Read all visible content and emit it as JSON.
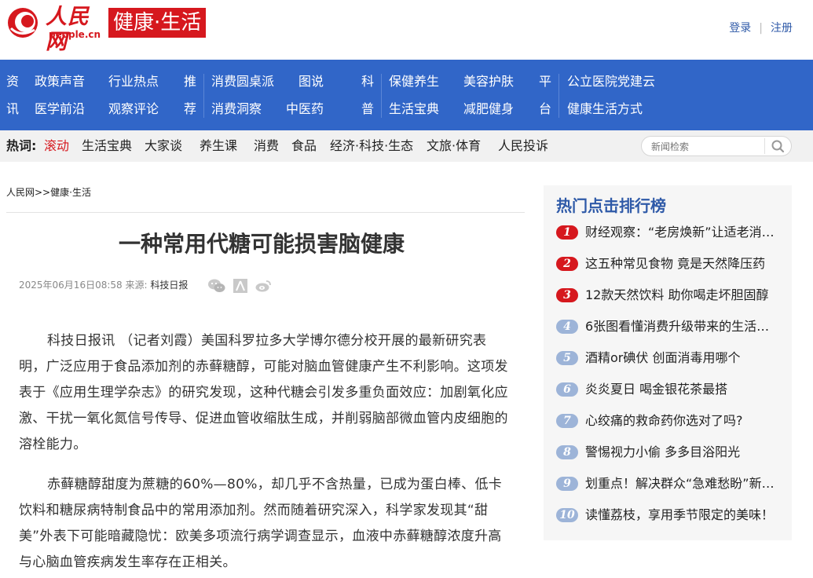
{
  "header": {
    "logo_text": "人民网",
    "logo_sub": "people.cn",
    "channel_title": "健康·生活",
    "login": "登录",
    "register": "注册"
  },
  "nav": {
    "groups": [
      {
        "category": [
          "资",
          "讯"
        ],
        "links": [
          [
            "政策声音",
            "行业热点"
          ],
          [
            "医学前沿",
            "观察评论"
          ]
        ]
      },
      {
        "category": [
          "推",
          "荐"
        ],
        "links": [
          [
            "消费圆桌派",
            "图说"
          ],
          [
            "消费洞察",
            "中医药"
          ]
        ]
      },
      {
        "category": [
          "科",
          "普"
        ],
        "links": [
          [
            "保健养生",
            "美容护肤"
          ],
          [
            "生活宝典",
            "减肥健身"
          ]
        ]
      },
      {
        "category": [
          "平",
          "台"
        ],
        "links": [
          [
            "公立医院党建云"
          ],
          [
            "健康生活方式"
          ]
        ]
      }
    ]
  },
  "hotbar": {
    "label": "热词:",
    "items": [
      "滚动",
      "生活宝典",
      "大家谈",
      "养生课",
      "消费",
      "食品",
      "经济·科技·生态",
      "文旅·体育",
      "人民投诉"
    ],
    "search_placeholder": "新闻检索"
  },
  "article": {
    "breadcrumb_home": "人民网>>",
    "breadcrumb_channel": "健康·生活",
    "title": "一种常用代糖可能损害脑健康",
    "date": "2025年06月16日08:58",
    "source_label": "来源:",
    "source": "科技日报",
    "paragraphs": [
      "科技日报讯 （记者刘霞）美国科罗拉多大学博尔德分校开展的最新研究表明，广泛应用于食品添加剂的赤藓糖醇，可能对脑血管健康产生不利影响。这项发表于《应用生理学杂志》的研究发现，这种代糖会引发多重负面效应：加剧氧化应激、干扰一氧化氮信号传导、促进血管收缩肽生成，并削弱脑部微血管内皮细胞的溶栓能力。",
      "赤藓糖醇甜度为蔗糖的60%—80%，却几乎不含热量，已成为蛋白棒、低卡饮料和糖尿病特制食品中的常用添加剂。然而随着研究深入，科学家发现其“甜美”外表下可能暗藏隐忧：欧美多项流行病学调查显示，血液中赤藓糖醇浓度升高与心脑血管疾病发生率存在正相关。"
    ]
  },
  "sidebar": {
    "title": "热门点击排行榜",
    "items": [
      {
        "rank": "1",
        "text": "财经观察：“老房焕新”让适老消…"
      },
      {
        "rank": "2",
        "text": "这五种常见食物 竟是天然降压药"
      },
      {
        "rank": "3",
        "text": "12款天然饮料 助你喝走坏胆固醇"
      },
      {
        "rank": "4",
        "text": "6张图看懂消费升级带来的生活…"
      },
      {
        "rank": "5",
        "text": "酒精or碘伏 创面消毒用哪个"
      },
      {
        "rank": "6",
        "text": "炎炎夏日 喝金银花茶最搭"
      },
      {
        "rank": "7",
        "text": "心绞痛的救命药你选对了吗?"
      },
      {
        "rank": "8",
        "text": "警惕视力小偷 多多目浴阳光"
      },
      {
        "rank": "9",
        "text": "划重点！解决群众“急难愁盼”新…"
      },
      {
        "rank": "10",
        "text": "读懂荔枝，享用季节限定的美味！"
      }
    ]
  },
  "colors": {
    "brand_red": "#d6181e",
    "nav_blue": "#3166c8",
    "link_blue": "#2f5aa8",
    "rank_cold": "#9db4d8"
  }
}
